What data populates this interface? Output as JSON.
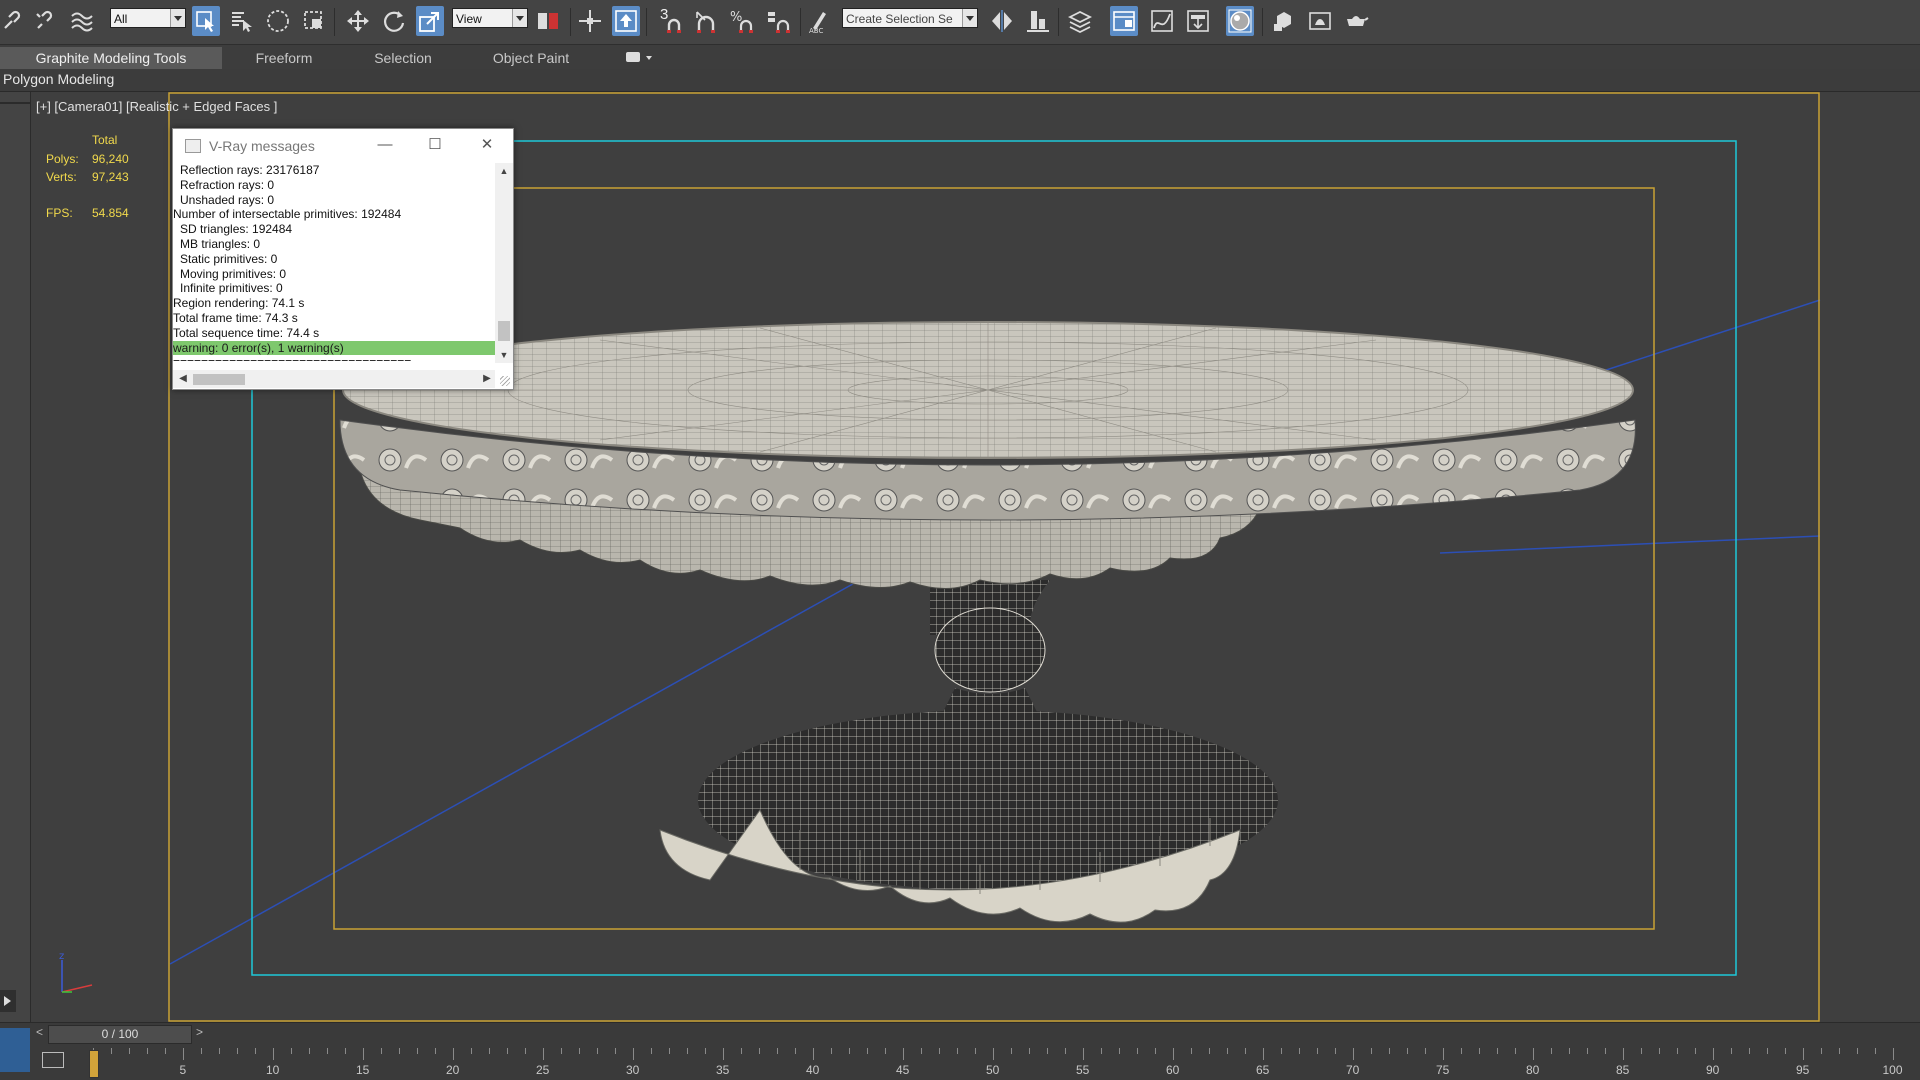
{
  "toolbar": {
    "filter_value": "All",
    "coord_value": "View",
    "snap_label": "3",
    "selection_set_placeholder": "Create Selection Se",
    "icons": [
      "link-icon",
      "unlink-icon",
      "bind-spacewarp-icon",
      "select-object-icon",
      "select-by-name-icon",
      "circle-selection-icon",
      "window-crossing-icon",
      "move-icon",
      "rotate-icon",
      "scale-icon",
      "manipulate-icon",
      "pivot-center-icon",
      "keyboard-shortcut-icon",
      "snap-toggle-icon",
      "angle-snap-icon",
      "percent-snap-icon",
      "spinner-snap-icon",
      "edit-named-selection-icon",
      "mirror-icon",
      "align-icon",
      "layer-explorer-icon",
      "scene-explorer-icon",
      "curve-editor-icon",
      "schematic-view-icon",
      "material-editor-icon",
      "render-setup-icon",
      "rendered-frame-icon",
      "render-icon"
    ]
  },
  "ribbon": {
    "tabs": [
      "Graphite Modeling Tools",
      "Freeform",
      "Selection",
      "Object Paint"
    ],
    "active_tab": "Graphite Modeling Tools",
    "panel_label": "Polygon Modeling"
  },
  "viewport": {
    "label": "[+] [Camera01] [Realistic + Edged Faces ]",
    "stats": {
      "header": "Total",
      "polys_label": "Polys:",
      "polys_value": "96,240",
      "verts_label": "Verts:",
      "verts_value": "97,243",
      "fps_label": "FPS:",
      "fps_value": "54.854"
    }
  },
  "vray_dialog": {
    "title": "V-Ray messages",
    "lines": [
      {
        "text": "Reflection rays: 23176187",
        "indent": true
      },
      {
        "text": "Refraction rays: 0",
        "indent": true
      },
      {
        "text": "Unshaded rays: 0",
        "indent": true
      },
      {
        "text": "Number of intersectable primitives: 192484",
        "indent": false
      },
      {
        "text": "SD triangles: 192484",
        "indent": true
      },
      {
        "text": "MB triangles: 0",
        "indent": true
      },
      {
        "text": "Static primitives: 0",
        "indent": true
      },
      {
        "text": "Moving primitives: 0",
        "indent": true
      },
      {
        "text": "Infinite primitives: 0",
        "indent": true
      },
      {
        "text": "Region rendering: 74.1 s",
        "indent": false
      },
      {
        "text": "Total frame time: 74.3 s",
        "indent": false
      },
      {
        "text": "Total sequence time: 74.4 s",
        "indent": false
      },
      {
        "text": "warning: 0 error(s), 1 warning(s)",
        "indent": false,
        "highlight": true
      },
      {
        "text": "==================================",
        "indent": false
      }
    ]
  },
  "timeline": {
    "frame_display": "0 / 100",
    "prev_arrow": "<",
    "next_arrow": ">",
    "ruler_labels": [
      "5",
      "10",
      "15",
      "20",
      "25",
      "30",
      "35",
      "40",
      "45",
      "50",
      "55",
      "60",
      "65",
      "70",
      "75",
      "80",
      "85",
      "90",
      "95",
      "100"
    ]
  },
  "colors": {
    "ui_bg": "#444444",
    "viewport_bg": "#3f3f3f",
    "stats_text": "#f1d94c",
    "safe_frame_outer": "#1ec8d8",
    "safe_frame_inner": "#c8a235",
    "warning_highlight": "#7ec86d",
    "active_button": "#5b8cc6"
  }
}
